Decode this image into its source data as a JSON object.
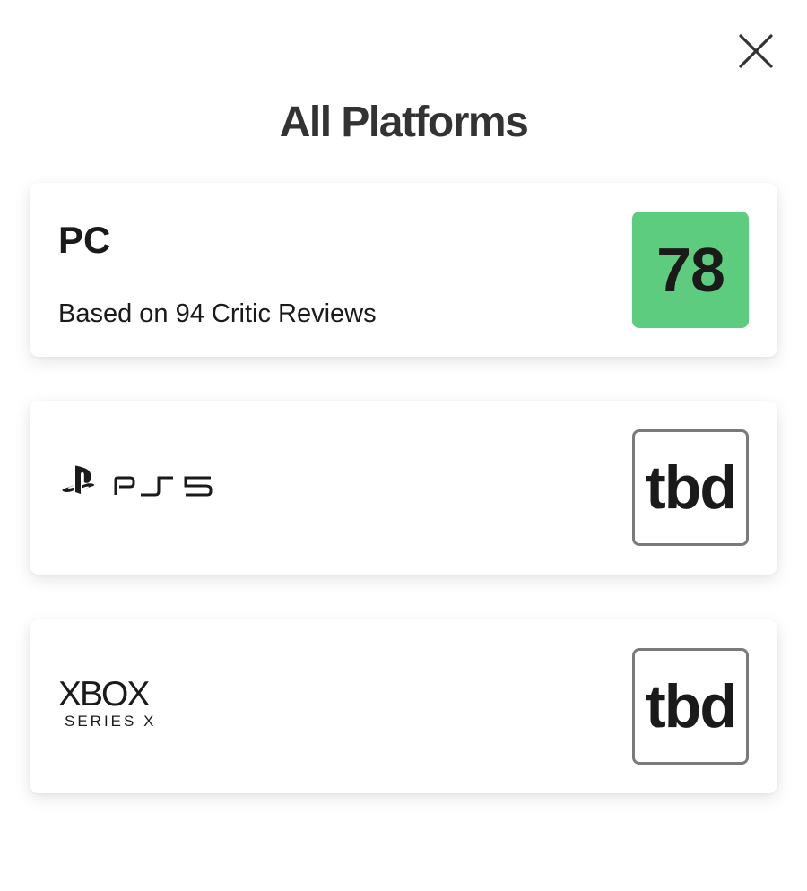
{
  "dialog": {
    "title": "All Platforms",
    "close_icon": "close-icon"
  },
  "platforms": [
    {
      "name": "PC",
      "reviews_text": "Based on 94 Critic Reviews",
      "score": "78",
      "score_color": "#5dcc7f"
    },
    {
      "name": "PS5",
      "logo_icon": "ps5-logo-icon",
      "score": "tbd"
    },
    {
      "name": "XBOX",
      "subtitle": "SERIES X",
      "logo_icon": "xbox-series-x-logo-icon",
      "score": "tbd"
    }
  ]
}
